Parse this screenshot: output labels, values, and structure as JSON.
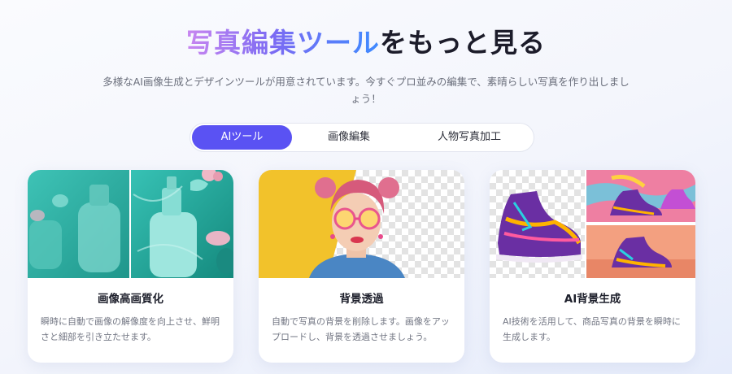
{
  "heading": {
    "highlight": "写真編集ツール",
    "rest": "をもっと見る"
  },
  "subtitle": "多様なAI画像生成とデザインツールが用意されています。今すぐプロ並みの編集で、素晴らしい写真を作り出しましょう！",
  "tabs": [
    {
      "label": "AIツール",
      "active": true
    },
    {
      "label": "画像編集",
      "active": false
    },
    {
      "label": "人物写真加工",
      "active": false
    }
  ],
  "cards": [
    {
      "title": "画像高画質化",
      "description": "瞬時に自動で画像の解像度を向上させ、鮮明さと細部を引き立たせます。",
      "image": "teal-bottles-before-after"
    },
    {
      "title": "背景透過",
      "description": "自動で写真の背景を削除します。画像をアップロードし、背景を透過させましょう。",
      "image": "woman-pink-hair-background-removed"
    },
    {
      "title": "AI背景生成",
      "description": "AI技術を活用して、商品写真の背景を瞬時に生成します。",
      "image": "sneaker-ai-backgrounds"
    }
  ],
  "colors": {
    "accent": "#5a52f3",
    "gradient_start": "#c986f0",
    "gradient_end": "#3f8bff"
  }
}
